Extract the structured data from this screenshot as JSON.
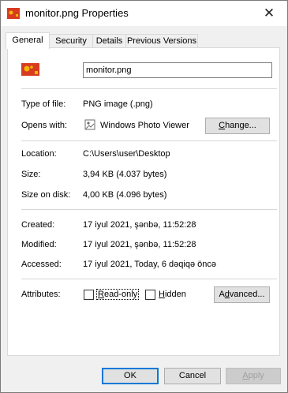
{
  "window": {
    "title": "monitor.png Properties",
    "close_glyph": "✕"
  },
  "tabs": [
    "General",
    "Security",
    "Details",
    "Previous Versions"
  ],
  "general": {
    "filename": "monitor.png",
    "type_label": "Type of file:",
    "type_value": "PNG image (.png)",
    "opens_label": "Opens with:",
    "opens_value": "Windows Photo Viewer",
    "change_prefix": "",
    "change_mnemonic": "C",
    "change_rest": "hange...",
    "location_label": "Location:",
    "location_value": "C:\\Users\\user\\Desktop",
    "size_label": "Size:",
    "size_value": "3,94 KB (4.037 bytes)",
    "size_disk_label": "Size on disk:",
    "size_disk_value": "4,00 KB (4.096 bytes)",
    "created_label": "Created:",
    "created_value": "17 iyul 2021, şənbə, 11:52:28",
    "modified_label": "Modified:",
    "modified_value": "17 iyul 2021, şənbə, 11:52:28",
    "accessed_label": "Accessed:",
    "accessed_value": "17 iyul 2021, Today, 6 dəqiqə öncə",
    "attributes_label": "Attributes:",
    "readonly_mnemonic": "R",
    "readonly_rest": "ead-only",
    "hidden_mnemonic": "H",
    "hidden_rest": "idden",
    "advanced_prefix": "A",
    "advanced_mnemonic": "d",
    "advanced_rest": "vanced..."
  },
  "footer": {
    "ok": "OK",
    "cancel": "Cancel",
    "apply_mnemonic": "A",
    "apply_rest": "pply"
  },
  "colors": {
    "accent": "#0078d7",
    "icon_red": "#d83b1f",
    "icon_yellow": "#f2b705"
  },
  "icons": {
    "title": "image-file-icon",
    "file": "image-file-icon",
    "viewer": "photo-viewer-icon"
  }
}
